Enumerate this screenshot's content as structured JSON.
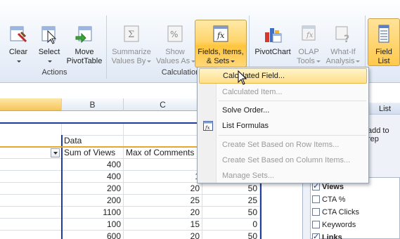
{
  "ribbon": {
    "groups": [
      {
        "label": "Actions"
      },
      {
        "label": "Calculation"
      }
    ],
    "buttons": {
      "clear": "Clear",
      "select": "Select",
      "move1": "Move",
      "move2": "PivotTable",
      "summarize1": "Summarize",
      "summarize2": "Values By",
      "show1": "Show",
      "show2": "Values As",
      "fields1": "Fields, Items,",
      "fields2": "& Sets",
      "pivotchart": "PivotChart",
      "olap1": "OLAP",
      "olap2": "Tools",
      "whatif1": "What-If",
      "whatif2": "Analysis",
      "fieldlist1": "Field",
      "fieldlist2": "List"
    }
  },
  "menu": {
    "items": [
      {
        "label": "Calculated Field...",
        "enabled": true,
        "highlighted": true
      },
      {
        "label": "Calculated Item...",
        "enabled": false
      },
      {
        "label": "Solve Order...",
        "enabled": true
      },
      {
        "label": "List Formulas",
        "enabled": true
      },
      {
        "label": "Create Set Based on Row Items...",
        "enabled": false
      },
      {
        "label": "Create Set Based on Column Items...",
        "enabled": false
      },
      {
        "label": "Manage Sets...",
        "enabled": false
      }
    ]
  },
  "sheet": {
    "columns": [
      "B",
      "C"
    ],
    "data_header": "Data",
    "col_headers": [
      "Sum of Views",
      "Max of Comments"
    ],
    "rows": [
      {
        "views": "400",
        "comments": "",
        "d": ""
      },
      {
        "views": "400",
        "comments": "1",
        "d": ""
      },
      {
        "views": "200",
        "comments": "20",
        "d": "50"
      },
      {
        "views": "200",
        "comments": "25",
        "d": "25"
      },
      {
        "views": "1100",
        "comments": "20",
        "d": "50"
      },
      {
        "views": "100",
        "comments": "15",
        "d": "0"
      },
      {
        "views": "600",
        "comments": "20",
        "d": "50"
      }
    ]
  },
  "pane": {
    "title": "List",
    "add_text": "add to rep",
    "fields": [
      {
        "label": "Views",
        "checked": true,
        "bold": true
      },
      {
        "label": "CTA %",
        "checked": false,
        "bold": false
      },
      {
        "label": "CTA Clicks",
        "checked": false,
        "bold": false
      },
      {
        "label": "Keywords",
        "checked": false,
        "bold": false
      },
      {
        "label": "Links",
        "checked": true,
        "bold": true
      }
    ]
  },
  "colors": {
    "accent": "#ffc53d",
    "border_blue": "#1f3c9b"
  }
}
